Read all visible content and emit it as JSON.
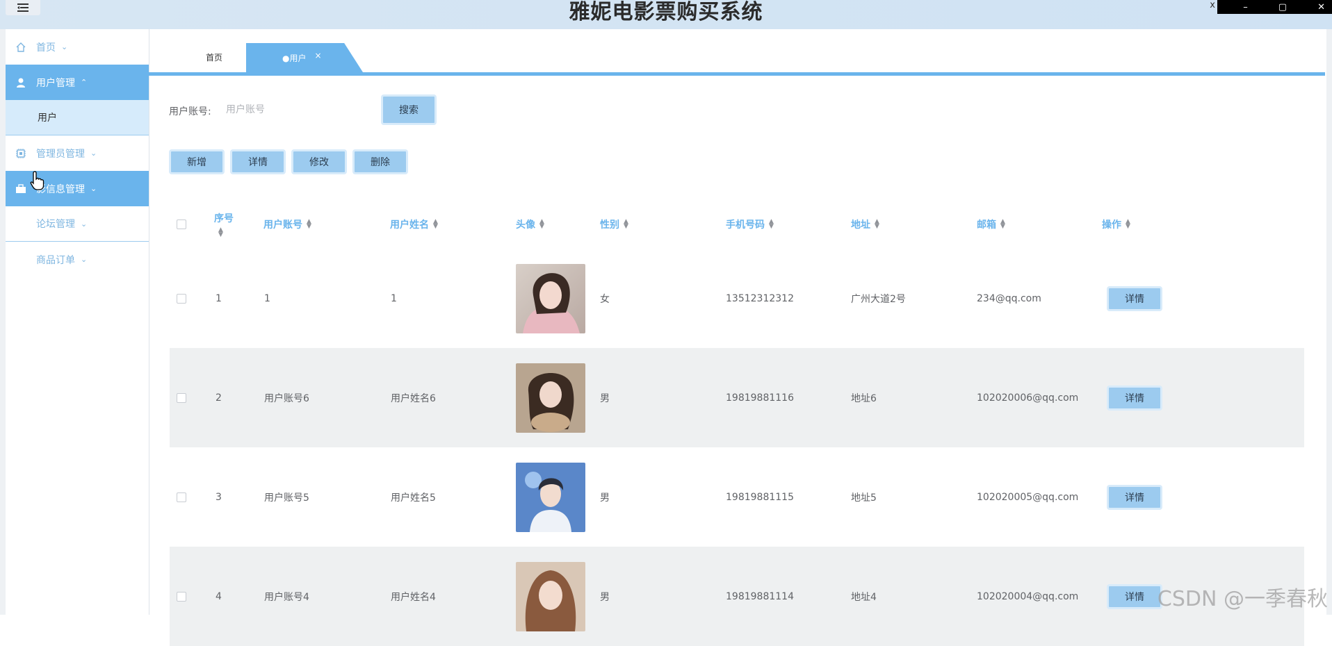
{
  "app": {
    "title": "雅妮电影票购买系统",
    "close_glyph": "x"
  },
  "window_controls": [
    "–",
    "▢",
    "✕"
  ],
  "sidebar": {
    "items": [
      {
        "label": "首页",
        "icon": "home-icon",
        "state": "normal"
      },
      {
        "label": "用户管理",
        "icon": "user-icon",
        "state": "active"
      },
      {
        "label": "用户",
        "icon": "",
        "state": "sub"
      },
      {
        "label": "管理员管理",
        "icon": "chip-icon",
        "state": "normal"
      },
      {
        "label": "影信息管理",
        "icon": "briefcase-icon",
        "state": "active"
      },
      {
        "label": "论坛管理",
        "icon": "",
        "state": "normal"
      },
      {
        "label": "商品订单",
        "icon": "",
        "state": "normal"
      }
    ]
  },
  "tabs": {
    "home": "首页",
    "current": "●用户",
    "close": "×"
  },
  "search": {
    "label": "用户账号:",
    "placeholder": "用户账号",
    "button": "搜索"
  },
  "toolbar": {
    "add": "新增",
    "detail": "详情",
    "edit": "修改",
    "delete": "删除"
  },
  "table": {
    "headers": [
      "序号",
      "用户账号",
      "用户姓名",
      "头像",
      "性别",
      "手机号码",
      "地址",
      "邮箱",
      "操作"
    ],
    "rows": [
      {
        "index": "1",
        "account": "1",
        "name": "1",
        "gender": "女",
        "phone": "13512312312",
        "address": "广州大道2号",
        "email": "234@qq.com",
        "action": "详情"
      },
      {
        "index": "2",
        "account": "用户账号6",
        "name": "用户姓名6",
        "gender": "男",
        "phone": "19819881116",
        "address": "地址6",
        "email": "102020006@qq.com",
        "action": "详情"
      },
      {
        "index": "3",
        "account": "用户账号5",
        "name": "用户姓名5",
        "gender": "男",
        "phone": "19819881115",
        "address": "地址5",
        "email": "102020005@qq.com",
        "action": "详情"
      },
      {
        "index": "4",
        "account": "用户账号4",
        "name": "用户姓名4",
        "gender": "男",
        "phone": "19819881114",
        "address": "地址4",
        "email": "102020004@qq.com",
        "action": "详情"
      }
    ]
  },
  "watermark": "CSDN @一季春秋",
  "colors": {
    "accent": "#6ab4ec",
    "button": "#9ccbef",
    "stripe": "#eef0f1"
  }
}
